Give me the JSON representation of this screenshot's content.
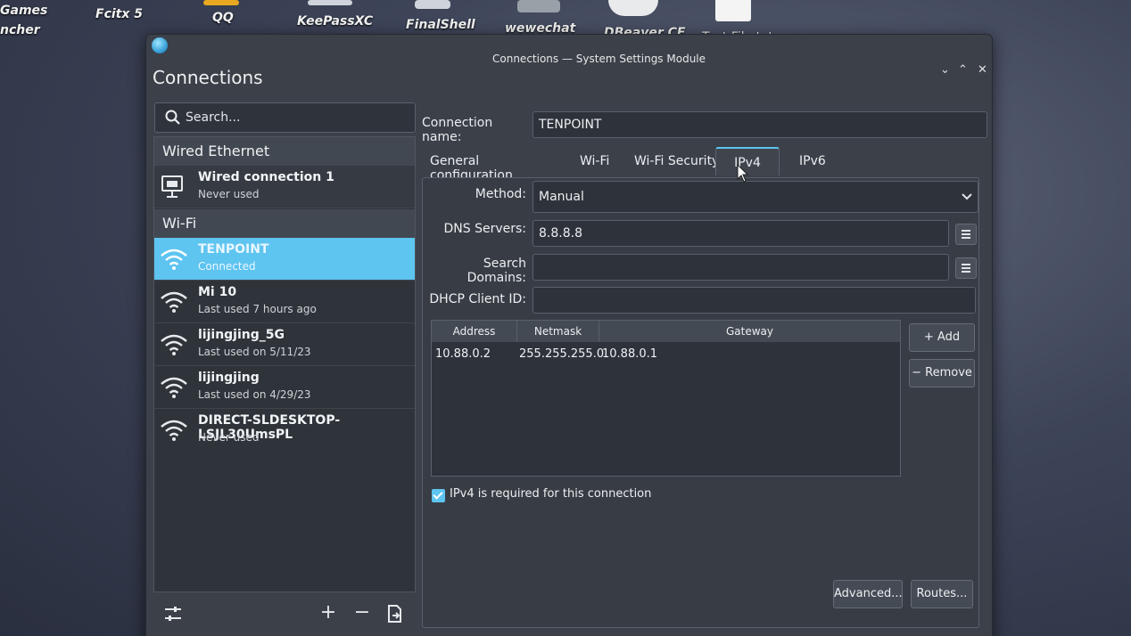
{
  "desktop": {
    "icons": [
      {
        "label": "Games",
        "name": "games"
      },
      {
        "label": "ncher",
        "name": "launcher"
      },
      {
        "label": "Fcitx 5",
        "name": "fcitx5"
      },
      {
        "label": "QQ",
        "name": "qq"
      },
      {
        "label": "KeePassXC",
        "name": "keepassxc"
      },
      {
        "label": "FinalShell",
        "name": "finalshell"
      },
      {
        "label": "wewechat",
        "name": "wewechat"
      },
      {
        "label": "DBeaver CE",
        "name": "dbeaver"
      },
      {
        "label": "Text File.txt",
        "name": "text-file"
      }
    ]
  },
  "window": {
    "title": "Connections — System Settings Module",
    "page_title": "Connections",
    "controls": [
      "minimize",
      "maximize",
      "close"
    ]
  },
  "search": {
    "placeholder": "Search..."
  },
  "connections": {
    "wired_header": "Wired Ethernet",
    "wired": [
      {
        "name": "Wired connection 1",
        "status": "Never used"
      }
    ],
    "wifi_header": "Wi-Fi",
    "wifi": [
      {
        "name": "TENPOINT",
        "status": "Connected",
        "selected": true
      },
      {
        "name": "Mi 10",
        "status": "Last used 7 hours ago"
      },
      {
        "name": "lijingjing_5G",
        "status": "Last used on 5/11/23"
      },
      {
        "name": "lijingjing",
        "status": "Last used on 4/29/23"
      },
      {
        "name": "DIRECT-SLDESKTOP-LSJL30UmsPL",
        "status": "Never used"
      }
    ]
  },
  "toolbar": {
    "settings_icon": "sliders-icon",
    "add_label": "+",
    "remove_label": "−",
    "export_icon": "export-icon"
  },
  "details": {
    "connection_name_label": "Connection name:",
    "connection_name_value": "TENPOINT",
    "tabs": [
      {
        "label": "General configuration"
      },
      {
        "label": "Wi-Fi"
      },
      {
        "label": "Wi-Fi Security"
      },
      {
        "label": "IPv4",
        "active": true
      },
      {
        "label": "IPv6"
      }
    ],
    "ipv4": {
      "method_label": "Method:",
      "method_value": "Manual",
      "dns_label": "DNS Servers:",
      "dns_value": "8.8.8.8",
      "search_domains_label": "Search Domains:",
      "search_domains_value": "",
      "dhcp_label": "DHCP Client ID:",
      "dhcp_value": "",
      "table_headers": [
        "Address",
        "Netmask",
        "Gateway"
      ],
      "rows": [
        {
          "address": "10.88.0.2",
          "netmask": "255.255.255.0",
          "gateway": "10.88.0.1"
        }
      ],
      "add_label": "+ Add",
      "remove_label": "− Remove",
      "required_label": "IPv4 is required for this connection",
      "required_checked": true,
      "advanced_label": "Advanced...",
      "routes_label": "Routes..."
    }
  },
  "colors": {
    "accent": "#5ec4f0",
    "window_bg": "#3b4049",
    "list_bg": "#2f343b"
  }
}
